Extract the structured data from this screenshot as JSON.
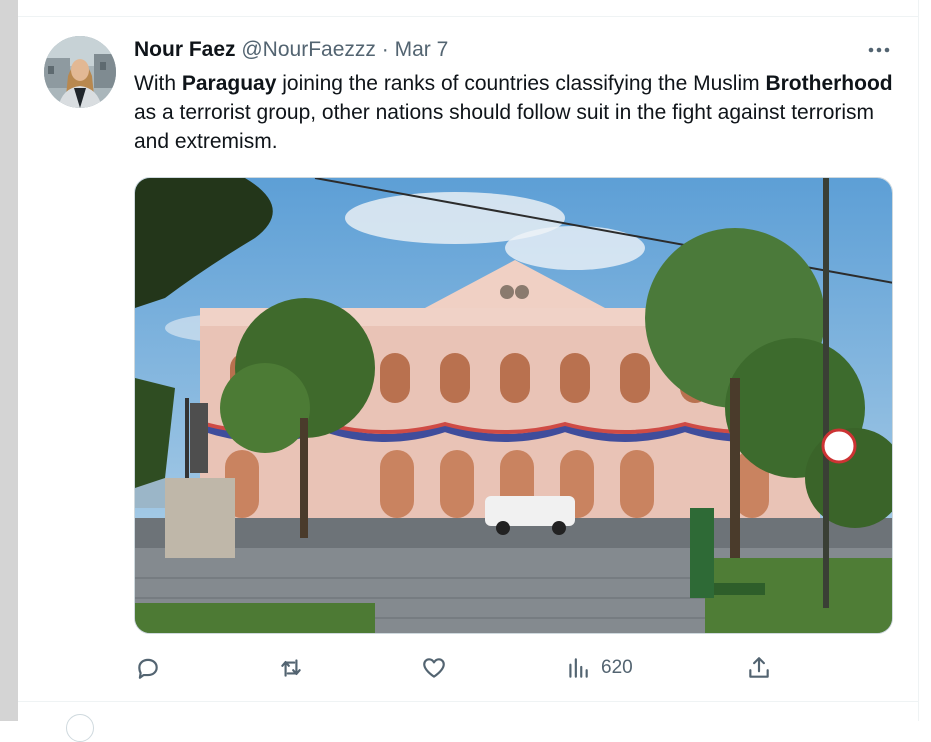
{
  "tweet": {
    "author_name": "Nour Faez",
    "handle": "@NourFaezzz",
    "separator": "·",
    "date": "Mar 7",
    "text_parts": [
      "With ",
      "Paraguay",
      " joining the ranks of countries classifying the Muslim ",
      "Brotherhood",
      " as a terrorist group, other nations should follow suit in the fight against terrorism and extremism."
    ]
  },
  "icons": {
    "more": "more-icon",
    "reply": "reply-icon",
    "retweet": "retweet-icon",
    "like": "like-icon",
    "views": "views-icon",
    "share": "share-icon"
  },
  "actions": {
    "views_count": "620"
  },
  "colors": {
    "text": "#0f1419",
    "secondary": "#536471",
    "divider": "#eff3f4"
  }
}
